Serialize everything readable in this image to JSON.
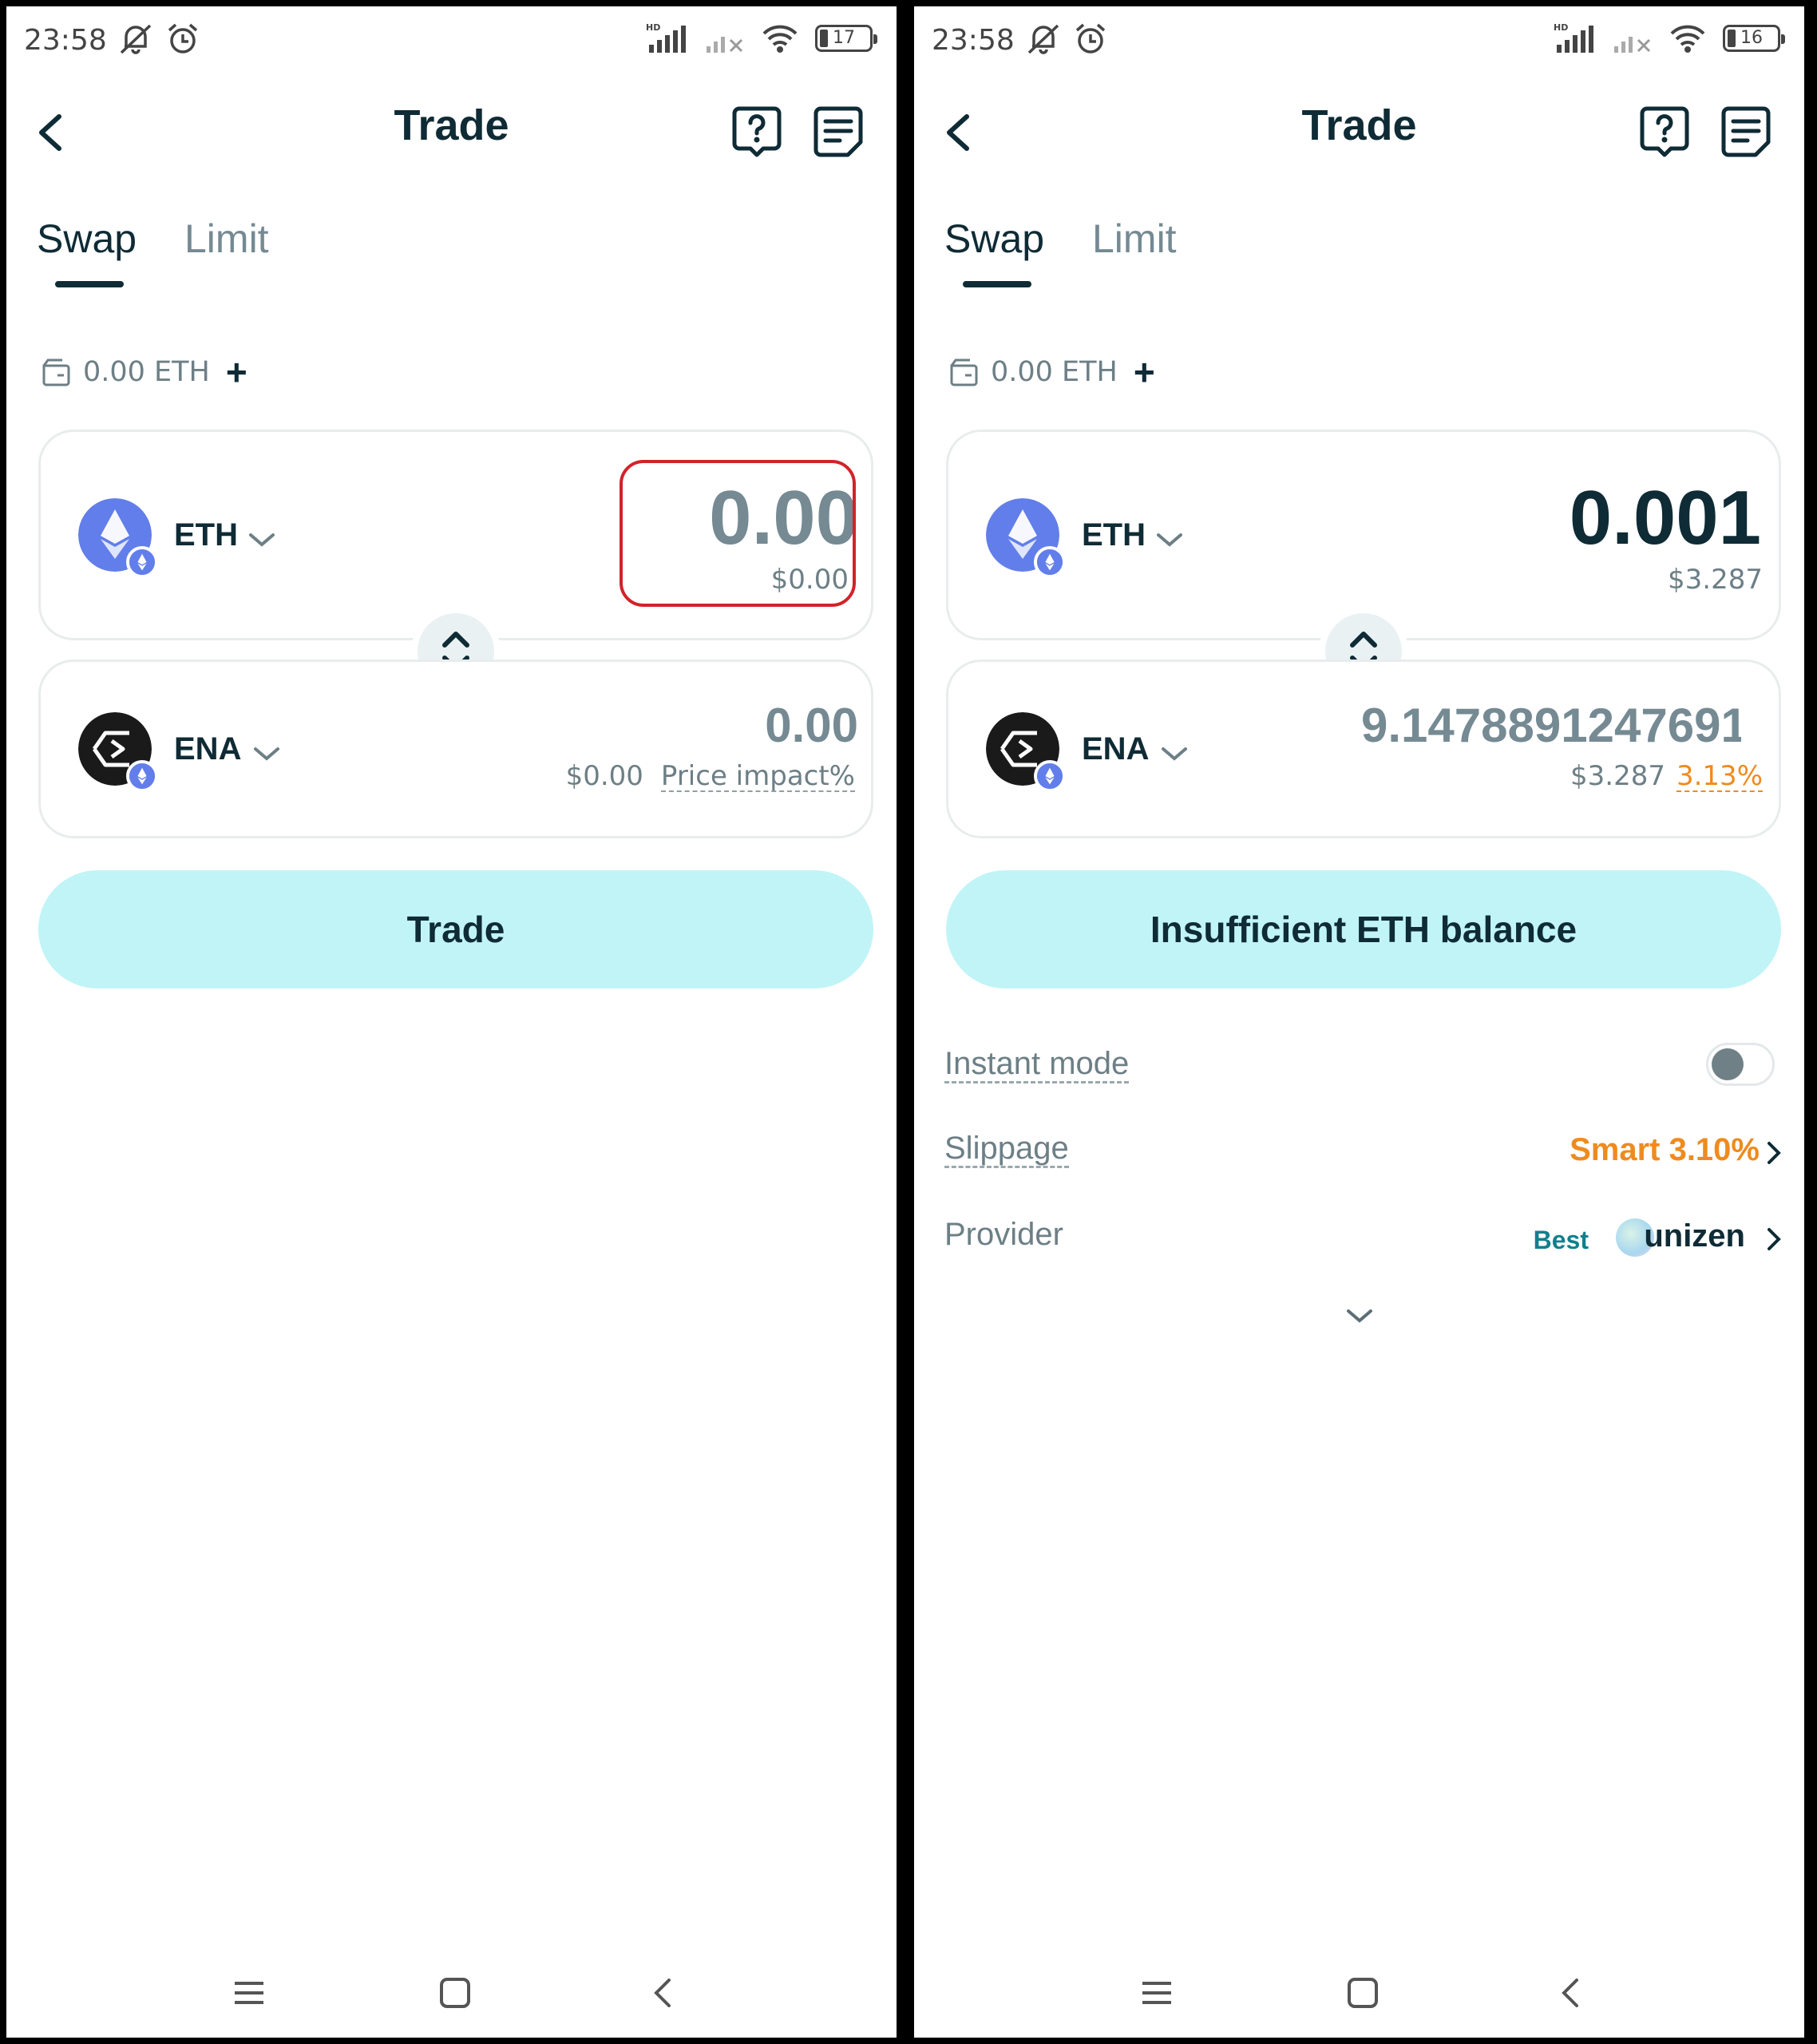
{
  "screens": [
    {
      "status": {
        "time": "23:58",
        "battery": "17"
      },
      "header": {
        "title": "Trade"
      },
      "tabs": {
        "swap": "Swap",
        "limit": "Limit"
      },
      "balance": {
        "text": "0.00 ETH"
      },
      "from": {
        "token": "ETH",
        "amount": "0.00",
        "usd": "$0.00"
      },
      "to": {
        "token": "ENA",
        "amount": "0.00",
        "usd": "$0.00",
        "impact": "Price impact%"
      },
      "button": {
        "label": "Trade"
      }
    },
    {
      "status": {
        "time": "23:58",
        "battery": "16"
      },
      "header": {
        "title": "Trade"
      },
      "tabs": {
        "swap": "Swap",
        "limit": "Limit"
      },
      "balance": {
        "text": "0.00 ETH"
      },
      "from": {
        "token": "ETH",
        "amount": "0.001",
        "usd": "$3.287"
      },
      "to": {
        "token": "ENA",
        "amount": "9.147889124769130",
        "usd": "$3.287",
        "impact": "3.13%"
      },
      "button": {
        "label": "Insufficient ETH balance"
      },
      "details": {
        "instant_mode": "Instant mode",
        "slippage_label": "Slippage",
        "slippage_value": "Smart 3.10%",
        "provider_label": "Provider",
        "provider_badge": "Best",
        "provider_name": "unizen"
      }
    }
  ],
  "colors": {
    "accent_button": "#c1f4f7",
    "dark_text": "#0f2b35",
    "warning_orange": "#ef8b1e",
    "highlight_red": "#d2232a",
    "eth_blue": "#627eea"
  }
}
